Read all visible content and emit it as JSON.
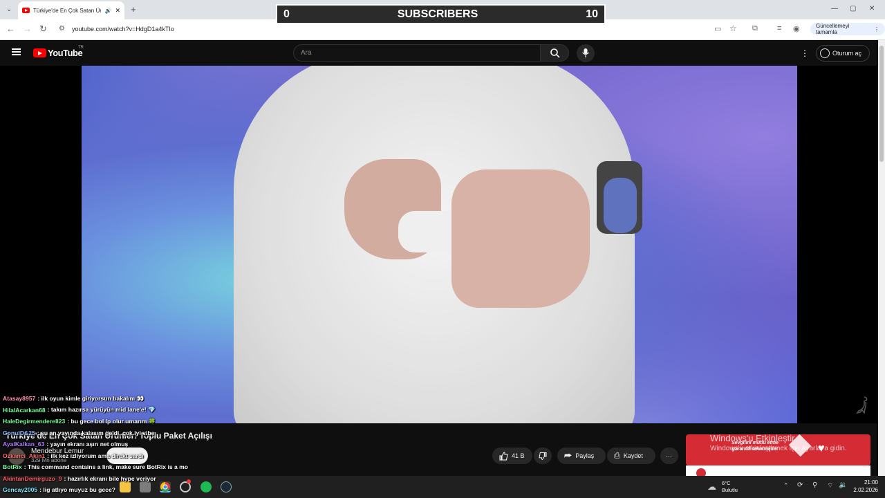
{
  "browser": {
    "tab_title": "Türkiye'de En Çok Satan Ür",
    "url": "youtube.com/watch?v=HdgD1a4kTIo",
    "update_label": "Güncellemeyi tamamla"
  },
  "overlay": {
    "sub_start": "0",
    "sub_label": "SUBSCRIBERS",
    "sub_goal": "10"
  },
  "youtube": {
    "logo_text": "YouTube",
    "region": "TR",
    "search_placeholder": "Ara",
    "signin_label": "Oturum aç",
    "video_title": "Türkiye'de En Çok Satan Ürünler! Toplu Paket Açılışı",
    "channel_name": "Mendebur Lemur",
    "subscriber_count": "329 Mn abone",
    "like_count": "41 B",
    "share_label": "Paylaş",
    "save_label": "Kaydet"
  },
  "ad": {
    "text": "Sevgilini mutlu etme garantili teknolojiler"
  },
  "windows": {
    "activate_title": "Windows'u Etkinleştir",
    "activate_sub": "Windows'u etkinleştirmek için Ayarlar'a gidin."
  },
  "chat": [
    {
      "user": "Atasay8957",
      "text": ": ilk oyun kimle giriyorsun bakalım 👀",
      "color": "#ff8fb0"
    },
    {
      "user": "HilalAcarkan68",
      "text": ": takım hazırsa yürüyün mid lane'e! 💎",
      "color": "#7dff9e"
    },
    {
      "user": "HaleDegirmenderell23",
      "text": ": bu gece bol lp olur umarım 🍀",
      "color": "#7dff9e"
    },
    {
      "user": "GonulD&25",
      "text": ": şu an yayında kalasım geldi, çok iyi vibe",
      "color": "#8fb7ff"
    },
    {
      "user": "AyalKalkan_63",
      "text": ": yayın ekranı aşırı net olmuş",
      "color": "#b07dff"
    },
    {
      "user": "Ozkanci_Akin1",
      "text": ": ilk kez izliyorum ama direkt sardı",
      "color": "#ff6b6b"
    },
    {
      "user": "BotRix",
      "text": ": This command contains a link, make sure BotRix is a mo",
      "color": "#7dff9e"
    },
    {
      "user": "AkintanDemirguzo_9",
      "text": ": hazırlık ekranı bile hype veriyor",
      "color": "#ff5b5b"
    },
    {
      "user": "Gencay2005",
      "text": ": lig atlıyo muyuz bu gece?",
      "color": "#7de7ff"
    }
  ],
  "taskbar": {
    "temperature": "6°C",
    "weather": "Bulutlu",
    "time": "21:00",
    "date": "2.02.2026"
  }
}
